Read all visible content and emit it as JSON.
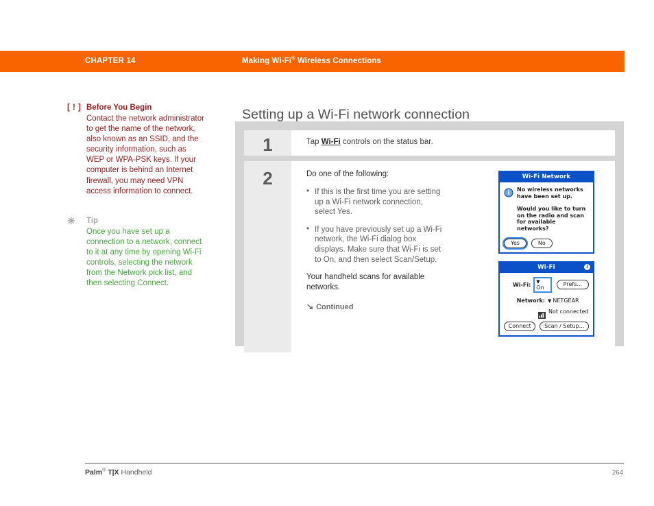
{
  "header": {
    "chapter": "CHAPTER 14",
    "title_pre": "Making Wi-Fi",
    "title_sup": "®",
    "title_post": " Wireless Connections",
    "band_color": "#fa6400"
  },
  "sidebar": {
    "warning": {
      "marker": "[ ! ]",
      "heading": "Before You Begin",
      "text": "Contact the network administrator to get the name of the network, also known as an SSID, and the security information, such as WEP or WPA-PSK keys. If your computer is behind an Internet firewall, you may need VPN access information to connect.",
      "color": "#9b1b1b"
    },
    "tip": {
      "marker": "✳",
      "heading": "Tip",
      "text": "Once you have set up a connection to a network, connect to it at any time by opening Wi-Fi controls, selecting the network from the Network pick list, and then selecting Connect.",
      "color": "#45ab3c",
      "heading_color": "#a6a6a6"
    }
  },
  "main": {
    "title": "Setting up a Wi-Fi network connection",
    "steps": [
      {
        "number": "1",
        "text_pre": "Tap ",
        "text_link": "Wi-Fi",
        "text_post": " controls on the status bar."
      },
      {
        "number": "2",
        "lead": "Do one of the following:",
        "bullets": [
          "If this is the first time you are setting up a Wi-Fi network connection, select Yes.",
          "If you have previously set up a Wi-Fi network, the Wi-Fi dialog box displays. Make sure that Wi-Fi is set to On, and then select Scan/Setup."
        ],
        "note": "Your handheld scans for available networks.",
        "continued_arrow": "↘",
        "continued_label": "Continued"
      }
    ]
  },
  "dialogs": {
    "wifi_network": {
      "title": "Wi-Fi Network",
      "icon": "info-icon",
      "message": "No wireless networks have been set up.",
      "question": "Would you like to turn on the radio and scan for available networks?",
      "buttons": [
        {
          "label": "Yes",
          "default": true
        },
        {
          "label": "No",
          "default": false
        }
      ],
      "accent": "#0b52c8"
    },
    "wifi": {
      "title": "Wi-Fi",
      "title_icon": "info-icon",
      "wifi_label": "Wi-Fi:",
      "wifi_value": "On",
      "prefs_button": "Prefs...",
      "network_label": "Network:",
      "network_value": "NETGEAR",
      "status_icon": "signal-strength-icon",
      "status_text": "Not connected",
      "buttons": [
        {
          "label": "Connect"
        },
        {
          "label": "Scan / Setup..."
        }
      ],
      "accent": "#0b52c8",
      "highlight": "#3a8de8"
    }
  },
  "footer": {
    "product_pre": "Palm",
    "product_sup": "®",
    "product_mid": " T|X",
    "product_post": " Handheld",
    "page_number": "264"
  }
}
